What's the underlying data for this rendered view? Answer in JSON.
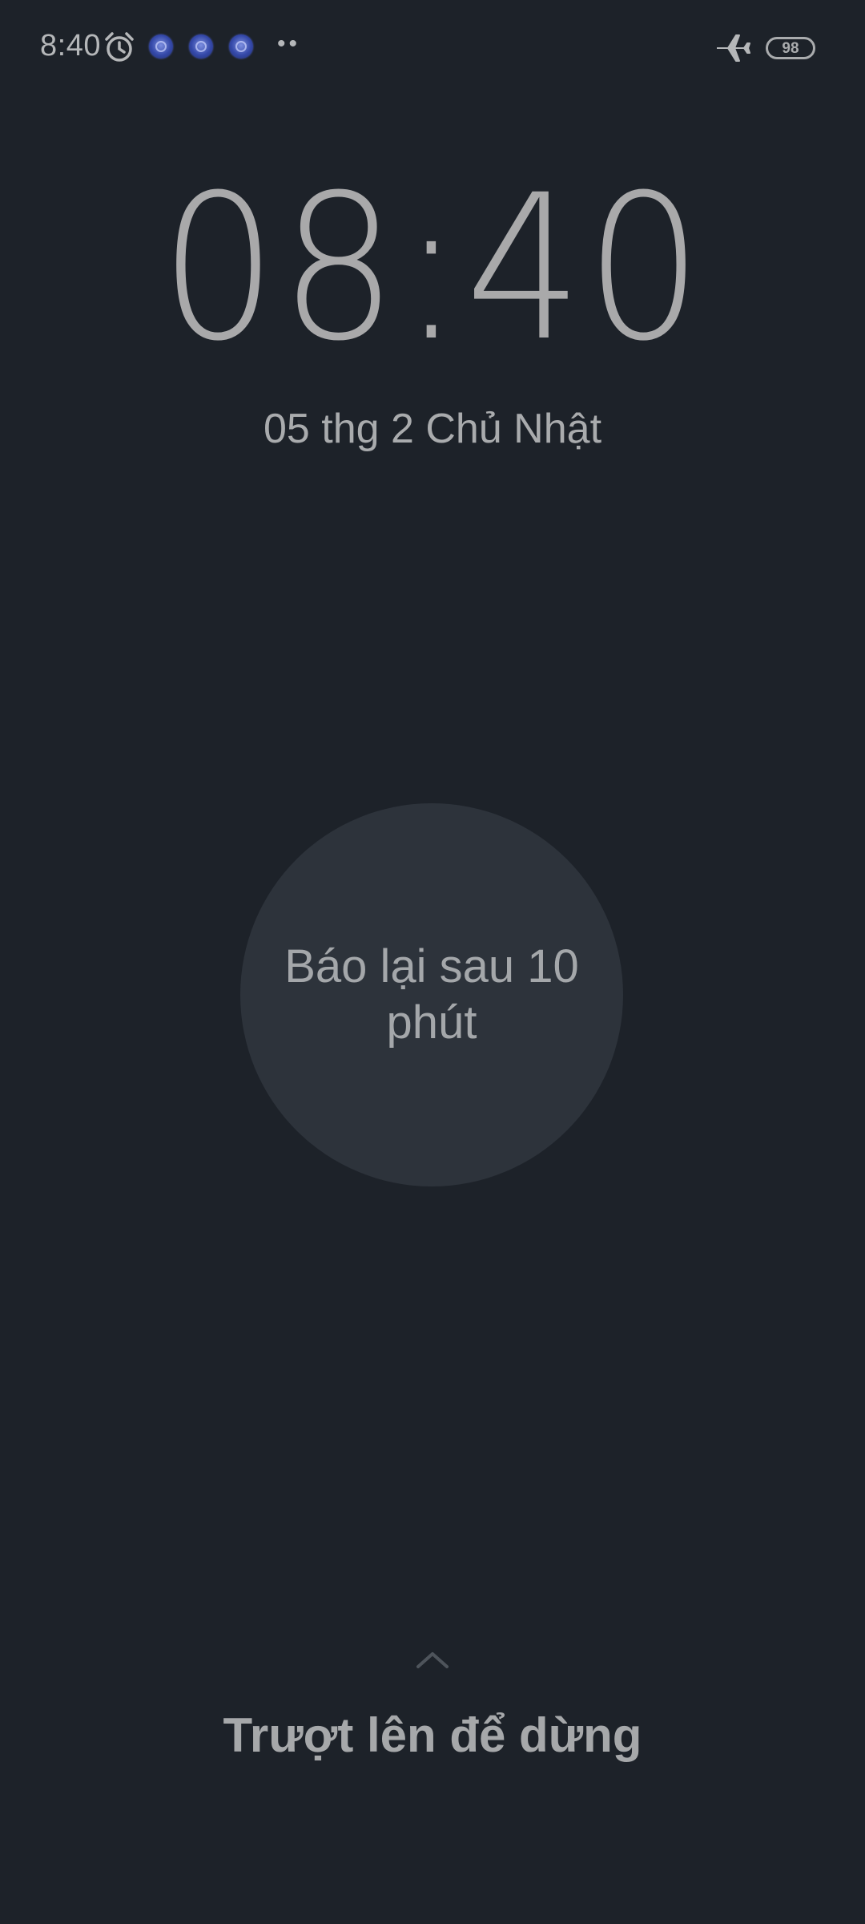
{
  "status_bar": {
    "time": "8:40",
    "alarm_icon": "alarm-clock-icon",
    "notification_icons": [
      "app-notification-icon",
      "app-notification-icon",
      "app-notification-icon"
    ],
    "more_indicator": "••",
    "airplane_icon": "airplane-mode-icon",
    "battery_level": "98"
  },
  "clock": {
    "time": "08:40",
    "date": "05 thg 2 Chủ Nhật"
  },
  "snooze": {
    "label": "Báo lại sau 10 phút"
  },
  "swipe": {
    "chevron_icon": "chevron-up-icon",
    "label": "Trượt lên để dừng"
  },
  "colors": {
    "background": "#1d2229",
    "snooze_circle": "#2d333b",
    "text": "#a9abad",
    "notification_accent": "#3448a8"
  }
}
